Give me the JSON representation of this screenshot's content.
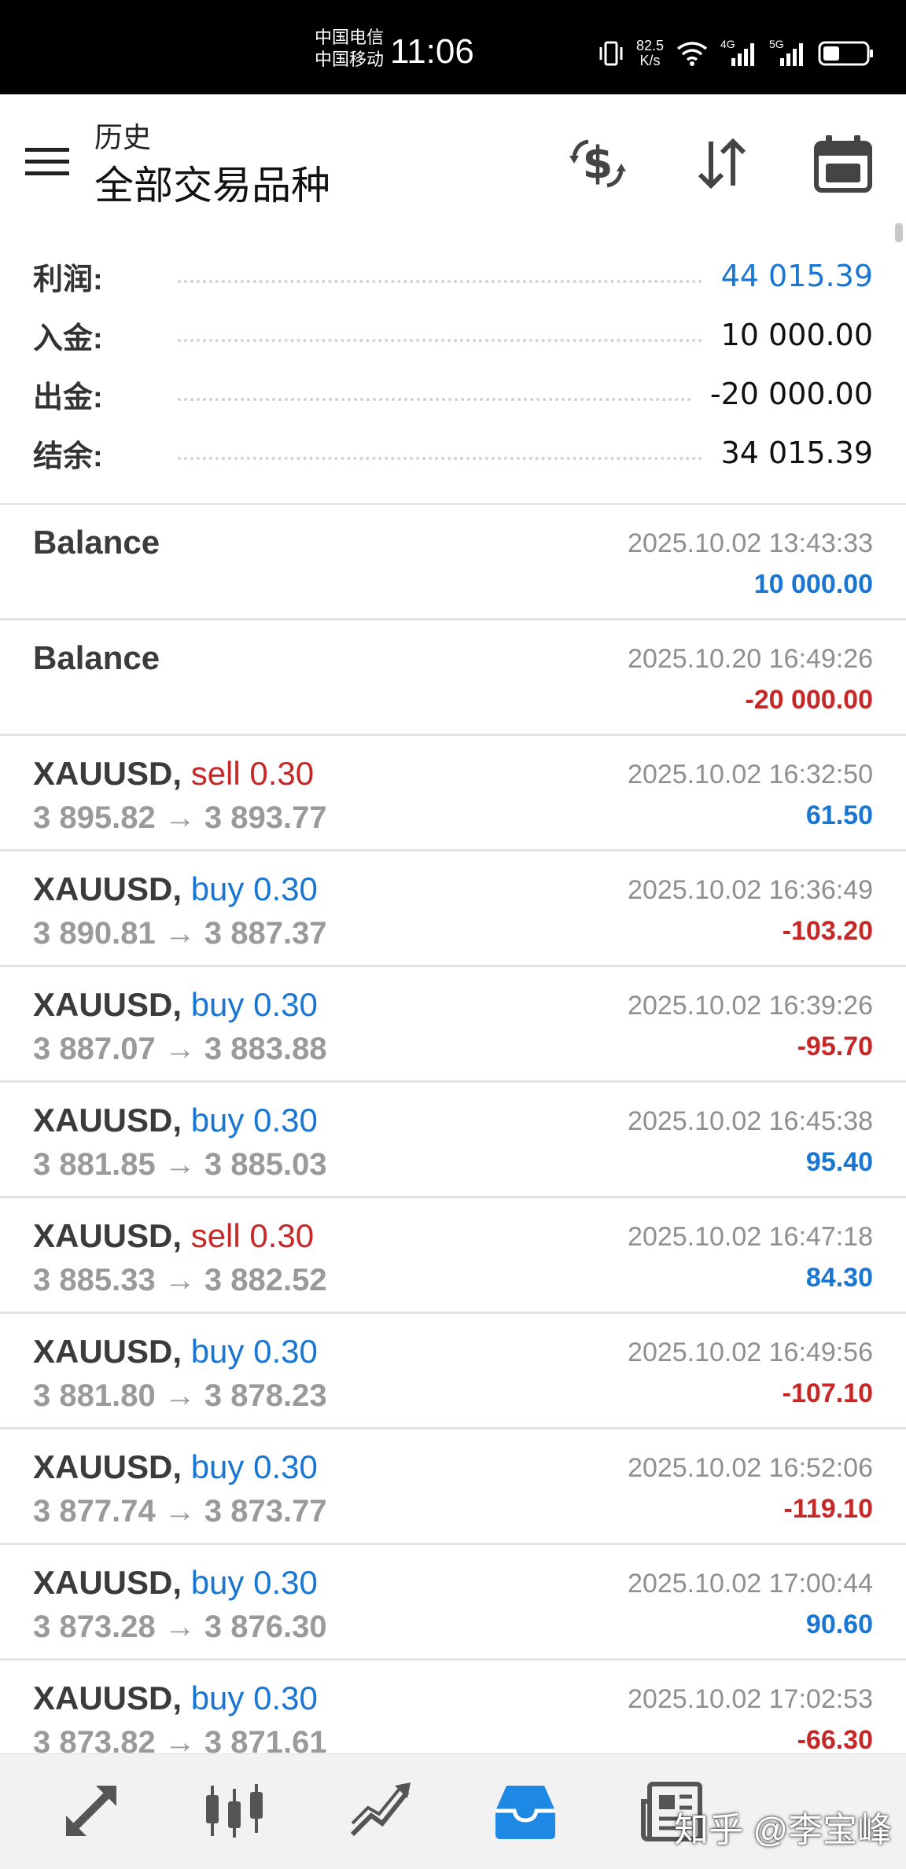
{
  "status_bar": {
    "carrier1": "中国电信",
    "carrier2": "中国移动",
    "time": "11:06",
    "net_speed": "82.5",
    "net_unit": "K/s",
    "network1": "4G",
    "network2": "5G"
  },
  "header": {
    "subtitle": "历史",
    "title": "全部交易品种"
  },
  "summary": {
    "profit_label": "利润:",
    "profit_value": "44 015.39",
    "deposit_label": "入金:",
    "deposit_value": "10 000.00",
    "withdraw_label": "出金:",
    "withdraw_value": "-20 000.00",
    "balance_label": "结余:",
    "balance_value": "34 015.39"
  },
  "balance_ops": [
    {
      "title": "Balance",
      "time": "2025.10.02 13:43:33",
      "amount": "10 000.00"
    },
    {
      "title": "Balance",
      "time": "2025.10.20 16:49:26",
      "amount": "-20 000.00"
    }
  ],
  "trades": [
    {
      "symbol": "XAUUSD,",
      "side": "sell 0.30",
      "prices": "3 895.82 → 3 893.77",
      "time": "2025.10.02 16:32:50",
      "profit": "61.50"
    },
    {
      "symbol": "XAUUSD,",
      "side": "buy 0.30",
      "prices": "3 890.81 → 3 887.37",
      "time": "2025.10.02 16:36:49",
      "profit": "-103.20"
    },
    {
      "symbol": "XAUUSD,",
      "side": "buy 0.30",
      "prices": "3 887.07 → 3 883.88",
      "time": "2025.10.02 16:39:26",
      "profit": "-95.70"
    },
    {
      "symbol": "XAUUSD,",
      "side": "buy 0.30",
      "prices": "3 881.85 → 3 885.03",
      "time": "2025.10.02 16:45:38",
      "profit": "95.40"
    },
    {
      "symbol": "XAUUSD,",
      "side": "sell 0.30",
      "prices": "3 885.33 → 3 882.52",
      "time": "2025.10.02 16:47:18",
      "profit": "84.30"
    },
    {
      "symbol": "XAUUSD,",
      "side": "buy 0.30",
      "prices": "3 881.80 → 3 878.23",
      "time": "2025.10.02 16:49:56",
      "profit": "-107.10"
    },
    {
      "symbol": "XAUUSD,",
      "side": "buy 0.30",
      "prices": "3 877.74 → 3 873.77",
      "time": "2025.10.02 16:52:06",
      "profit": "-119.10"
    },
    {
      "symbol": "XAUUSD,",
      "side": "buy 0.30",
      "prices": "3 873.28 → 3 876.30",
      "time": "2025.10.02 17:00:44",
      "profit": "90.60"
    },
    {
      "symbol": "XAUUSD,",
      "side": "buy 0.30",
      "prices": "3 873.82 → 3 871.61",
      "time": "2025.10.02 17:02:53",
      "profit": "-66.30"
    }
  ],
  "bottom_nav": {
    "items": [
      "quotes-icon",
      "chart-icon",
      "trade-icon",
      "history-icon",
      "news-icon"
    ],
    "active": "history-icon"
  },
  "watermark": "知乎 @李宝峰",
  "colors": {
    "accent_blue": "#1976d2",
    "loss_red": "#c62828",
    "muted_gray": "#9a9a9a"
  }
}
